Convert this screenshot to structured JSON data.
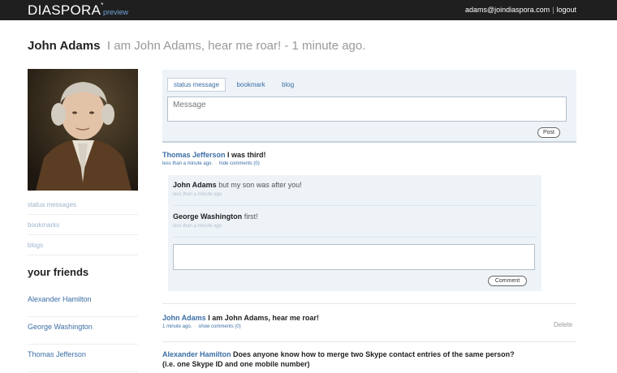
{
  "topbar": {
    "brand": "DIASPORA",
    "brand_mark": "*",
    "brand_sub": "preview",
    "user_email": "adams@joindiaspora.com",
    "separator": "|",
    "logout": "logout"
  },
  "header": {
    "name": "John Adams",
    "status": "I am John Adams, hear me roar! - 1 minute ago."
  },
  "sidebar": {
    "links": [
      {
        "label": "status messages"
      },
      {
        "label": "bookmarks"
      },
      {
        "label": "blogs"
      }
    ],
    "friends_title": "your friends",
    "friends": [
      {
        "name": "Alexander Hamilton"
      },
      {
        "name": "George Washington"
      },
      {
        "name": "Thomas Jefferson"
      }
    ]
  },
  "publisher": {
    "tabs": [
      {
        "label": "status message"
      },
      {
        "label": "bookmark"
      },
      {
        "label": "blog"
      }
    ],
    "placeholder": "Message",
    "post_label": "Post"
  },
  "stream": {
    "post1": {
      "author": "Thomas Jefferson",
      "text": "I was third!",
      "time": "less than a minute ago.",
      "toggle": "hide comments (0)"
    },
    "comments": [
      {
        "author": "John Adams",
        "text": "but my son was after you!",
        "time": "less than a minute ago"
      },
      {
        "author": "George Washington",
        "text": "first!",
        "time": "less than a minute ago"
      }
    ],
    "comment_button": "Comment",
    "post2": {
      "author": "John Adams",
      "text": "I am John Adams, hear me roar!",
      "time": "1 minute ago.",
      "toggle": "show comments (0)",
      "delete": "Delete"
    },
    "post3": {
      "author": "Alexander Hamilton",
      "text": "Does anyone know how to merge two Skype contact entries of the same person?",
      "text2": "(i.e. one Skype ID and one mobile number)"
    }
  }
}
